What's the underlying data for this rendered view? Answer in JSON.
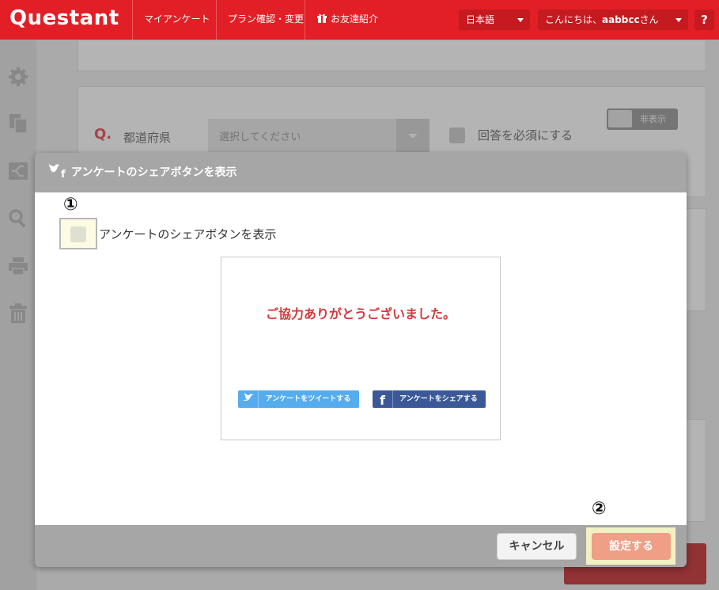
{
  "header": {
    "logo": "Questant",
    "nav": [
      "マイアンケート",
      "プラン確認・変更",
      "お友達紹介"
    ],
    "language": "日本語",
    "user_greeting_prefix": "こんにちは、",
    "user_name": "aabbcc",
    "user_greeting_suffix": "さん",
    "help": "?"
  },
  "sidebar": {
    "icons": [
      "gear-icon",
      "copy-icon",
      "branch-icon",
      "search-icon",
      "print-icon",
      "trash-icon"
    ]
  },
  "background": {
    "question_mark": "Q.",
    "question_text": "都道府県",
    "select_placeholder": "選択してください",
    "required_label": "回答を必須にする",
    "toggle_label": "非表示"
  },
  "modal": {
    "title": "アンケートのシェアボタンを表示",
    "step1": "①",
    "step2": "②",
    "checkbox_label": "アンケートのシェアボタンを表示",
    "checkbox_checked": false,
    "preview": {
      "thanks_message": "ご協力ありがとうございました。",
      "tweet_button": "アンケートをツイートする",
      "facebook_button": "アンケートをシェアする"
    },
    "cancel_button": "キャンセル",
    "submit_button": "設定する"
  },
  "colors": {
    "brand_red": "#e21f26",
    "twitter_blue": "#55acee",
    "facebook_blue": "#3b5998",
    "submit_salmon": "#ee9f86"
  }
}
